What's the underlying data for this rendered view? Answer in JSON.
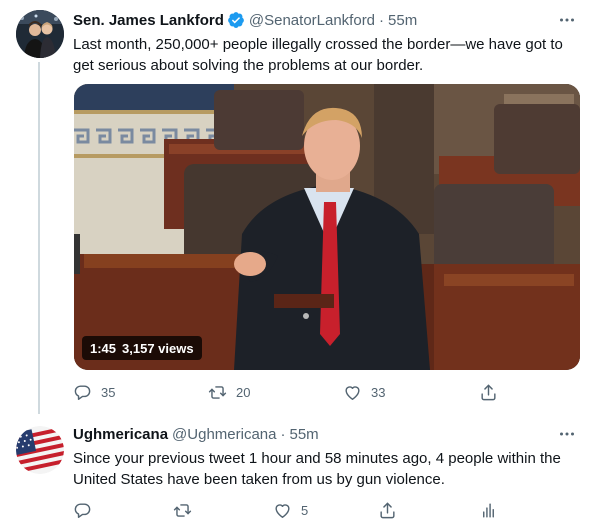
{
  "tweets": [
    {
      "author": {
        "name": "Sen. James Lankford",
        "handle": "@SenatorLankford",
        "verified": true
      },
      "separator": "·",
      "time": "55m",
      "text": "Last month, 250,000+ people illegally crossed the border—we have got to get serious about solving the problems at our border.",
      "video": {
        "duration": "1:45",
        "views": "3,157 views"
      },
      "actions": {
        "replies": "35",
        "retweets": "20",
        "likes": "33"
      }
    },
    {
      "author": {
        "name": "Ughmericana",
        "handle": "@Ughmericana"
      },
      "separator": "·",
      "time": "55m",
      "text": "Since your previous tweet 1 hour and 58 minutes ago, 4 people within the United States have been taken from us by gun violence.",
      "actions": {
        "likes": "5"
      }
    }
  ],
  "colors": {
    "verified": "#1d9bf0",
    "secondary_text": "#536471",
    "thread_line": "#cfd9de"
  },
  "icons": [
    "verified-icon",
    "more-icon",
    "reply-icon",
    "retweet-icon",
    "like-icon",
    "share-icon",
    "analytics-icon"
  ]
}
